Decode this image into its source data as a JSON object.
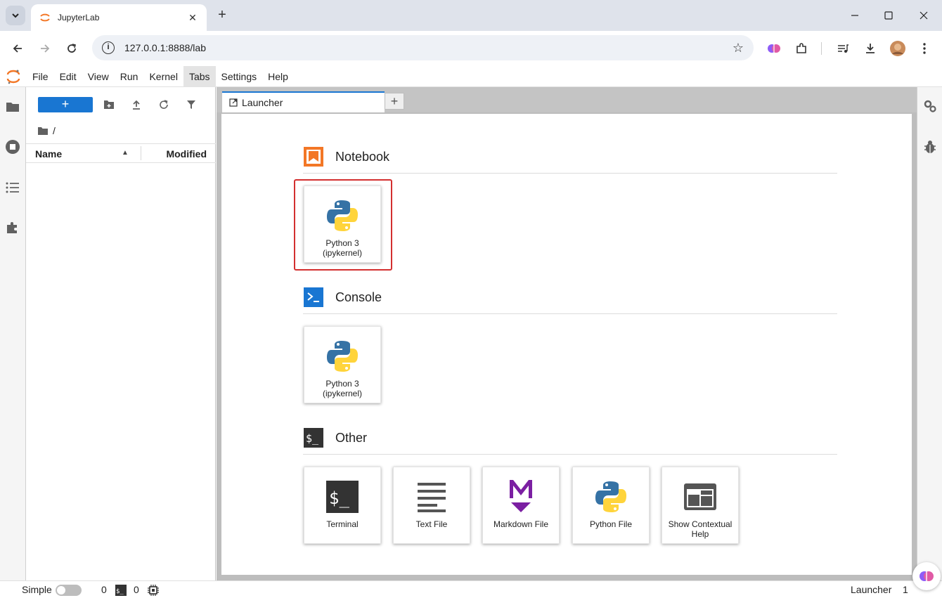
{
  "browser": {
    "tab_title": "JupyterLab",
    "url": "127.0.0.1:8888/lab"
  },
  "menu": {
    "items": [
      "File",
      "Edit",
      "View",
      "Run",
      "Kernel",
      "Tabs",
      "Settings",
      "Help"
    ],
    "active": "Tabs"
  },
  "filebrowser": {
    "new_label": "+",
    "breadcrumb": "/",
    "col_name": "Name",
    "col_modified": "Modified"
  },
  "dock": {
    "active_tab": "Launcher",
    "add_tab_label": "+"
  },
  "launcher": {
    "sections": [
      {
        "title": "Notebook",
        "cards": [
          {
            "label": "Python 3\n(ipykernel)",
            "icon": "python-logo-icon"
          }
        ]
      },
      {
        "title": "Console",
        "cards": [
          {
            "label": "Python 3\n(ipykernel)",
            "icon": "python-logo-icon"
          }
        ]
      },
      {
        "title": "Other",
        "cards": [
          {
            "label": "Terminal",
            "icon": "terminal-icon"
          },
          {
            "label": "Text File",
            "icon": "text-file-icon"
          },
          {
            "label": "Markdown File",
            "icon": "markdown-icon"
          },
          {
            "label": "Python File",
            "icon": "python-logo-icon"
          },
          {
            "label": "Show Contextual\nHelp",
            "icon": "contextual-help-icon"
          }
        ]
      }
    ],
    "highlighted_card": "notebook-python3"
  },
  "statusbar": {
    "mode_label": "Simple",
    "simple_mode_on": false,
    "terminals_count": "0",
    "kernels_count": "0",
    "active_label": "Launcher",
    "tab_index": "1"
  },
  "colors": {
    "accent": "#1976d2",
    "highlight_border": "#d32f2f",
    "jupyter_orange": "#f37726",
    "markdown_purple": "#7b1fa2",
    "python_blue": "#3572a5",
    "python_yellow": "#ffd43b"
  }
}
